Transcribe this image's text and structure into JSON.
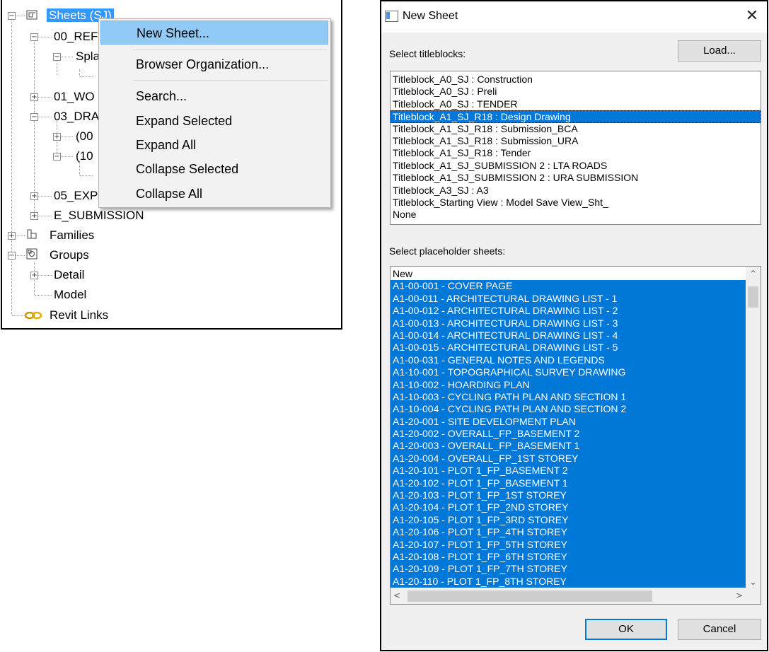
{
  "browser": {
    "tree": {
      "sheets": "Sheets (SJ)",
      "ref": "00_REF",
      "spla": "Spla",
      "wo": "01_WO",
      "dra": "03_DRA",
      "child_00": "(00",
      "child_10": "(10",
      "exp": "05_EXP",
      "submission": "E_SUBMISSION",
      "families": "Families",
      "groups": "Groups",
      "detail": "Detail",
      "model": "Model",
      "revit_links": "Revit Links"
    },
    "context_menu": {
      "new_sheet": "New Sheet...",
      "browser_org": "Browser Organization...",
      "search": "Search...",
      "expand_selected": "Expand Selected",
      "expand_all": "Expand All",
      "collapse_selected": "Collapse Selected",
      "collapse_all": "Collapse All"
    }
  },
  "dialog": {
    "title": "New Sheet",
    "close": "✕",
    "titleblocks_label": "Select titleblocks:",
    "load_button": "Load...",
    "titleblocks": [
      "Titleblock_A0_SJ : Construction",
      "Titleblock_A0_SJ : Preli",
      "Titleblock_A0_SJ : TENDER",
      "Titleblock_A1_SJ_R18 : Design Drawing",
      "Titleblock_A1_SJ_R18 : Submission_BCA",
      "Titleblock_A1_SJ_R18 : Submission_URA",
      "Titleblock_A1_SJ_R18 : Tender",
      "Titleblock_A1_SJ_SUBMISSION 2 : LTA ROADS",
      "Titleblock_A1_SJ_SUBMISSION 2 : URA SUBMISSION",
      "Titleblock_A3_SJ : A3",
      "Titleblock_Starting View : Model Save View_Sht_",
      "None"
    ],
    "titleblock_selected_index": 3,
    "placeholder_label": "Select placeholder sheets:",
    "placeholders": [
      "New",
      "A1-00-001 - COVER PAGE",
      "A1-00-011 - ARCHITECTURAL DRAWING LIST - 1",
      "A1-00-012 - ARCHITECTURAL DRAWING LIST - 2",
      "A1-00-013 - ARCHITECTURAL DRAWING LIST - 3",
      "A1-00-014 - ARCHITECTURAL DRAWING LIST - 4",
      "A1-00-015 - ARCHITECTURAL DRAWING LIST - 5",
      "A1-00-031 - GENERAL NOTES AND LEGENDS",
      "A1-10-001 - TOPOGRAPHICAL SURVEY DRAWING",
      "A1-10-002 - HOARDING PLAN",
      "A1-10-003 - CYCLING PATH PLAN AND SECTION 1",
      "A1-10-004 - CYCLING PATH PLAN AND SECTION 2",
      "A1-20-001 - SITE DEVELOPMENT PLAN",
      "A1-20-002 - OVERALL_FP_BASEMENT 2",
      "A1-20-003 - OVERALL_FP_BASEMENT 1",
      "A1-20-004 - OVERALL_FP_1ST STOREY",
      "A1-20-101 - PLOT 1_FP_BASEMENT 2",
      "A1-20-102 - PLOT 1_FP_BASEMENT 1",
      "A1-20-103 - PLOT 1_FP_1ST STOREY",
      "A1-20-104 - PLOT 1_FP_2ND STOREY",
      "A1-20-105 - PLOT 1_FP_3RD STOREY",
      "A1-20-106 - PLOT 1_FP_4TH STOREY",
      "A1-20-107 - PLOT 1_FP_5TH STOREY",
      "A1-20-108 - PLOT 1_FP_6TH STOREY",
      "A1-20-109 - PLOT 1_FP_7TH STOREY",
      "A1-20-110 - PLOT 1_FP_8TH STOREY"
    ],
    "ok_button": "OK",
    "cancel_button": "Cancel",
    "accent_color": "#0078d7"
  }
}
